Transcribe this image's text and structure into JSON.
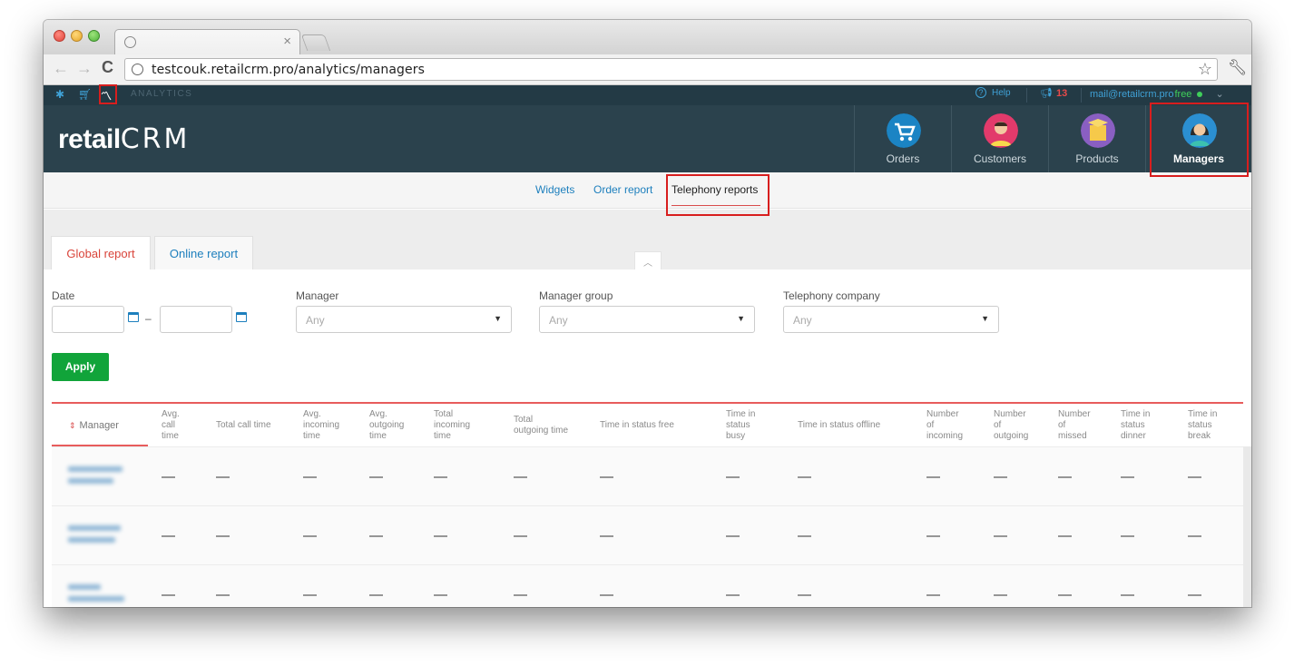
{
  "browser": {
    "url": "testcouk.retailcrm.pro/analytics/managers"
  },
  "topbar": {
    "section_label": "ANALYTICS",
    "help_label": "Help",
    "notifications_count": "13",
    "user_email": "mail@retailcrm.pro",
    "plan_label": "free"
  },
  "header": {
    "logo_text": "retail",
    "logo_crm": "CRM",
    "modules": [
      {
        "label": "Orders"
      },
      {
        "label": "Customers"
      },
      {
        "label": "Products"
      },
      {
        "label": "Managers"
      }
    ]
  },
  "subnav": {
    "items": [
      "Widgets",
      "Order report",
      "Telephony reports"
    ]
  },
  "report_tabs": {
    "global": "Global report",
    "online": "Online report"
  },
  "filters": {
    "date_label": "Date",
    "date_separator": "–",
    "manager_label": "Manager",
    "manager_placeholder": "Any",
    "group_label": "Manager group",
    "group_placeholder": "Any",
    "company_label": "Telephony company",
    "company_placeholder": "Any",
    "apply_label": "Apply"
  },
  "table": {
    "columns": [
      "Manager",
      "Avg.\ncall\ntime",
      "Total call time",
      "Avg.\nincoming\ntime",
      "Avg.\noutgoing\ntime",
      "Total\nincoming\ntime",
      "Total\noutgoing time",
      "Time in status free",
      "Time in\nstatus\nbusy",
      "Time in status offline",
      "Number\nof\nincoming",
      "Number\nof\noutgoing",
      "Number\nof\nmissed",
      "Time in\nstatus\ndinner",
      "Time in\nstatus\nbreak"
    ],
    "empty_value": "—",
    "row_count": 3
  },
  "colors": {
    "header_bg": "#2b424d",
    "topstrip_bg": "#233a45",
    "accent_red": "#d9443a",
    "link_blue": "#1d7fbd",
    "apply_green": "#11a43a"
  }
}
